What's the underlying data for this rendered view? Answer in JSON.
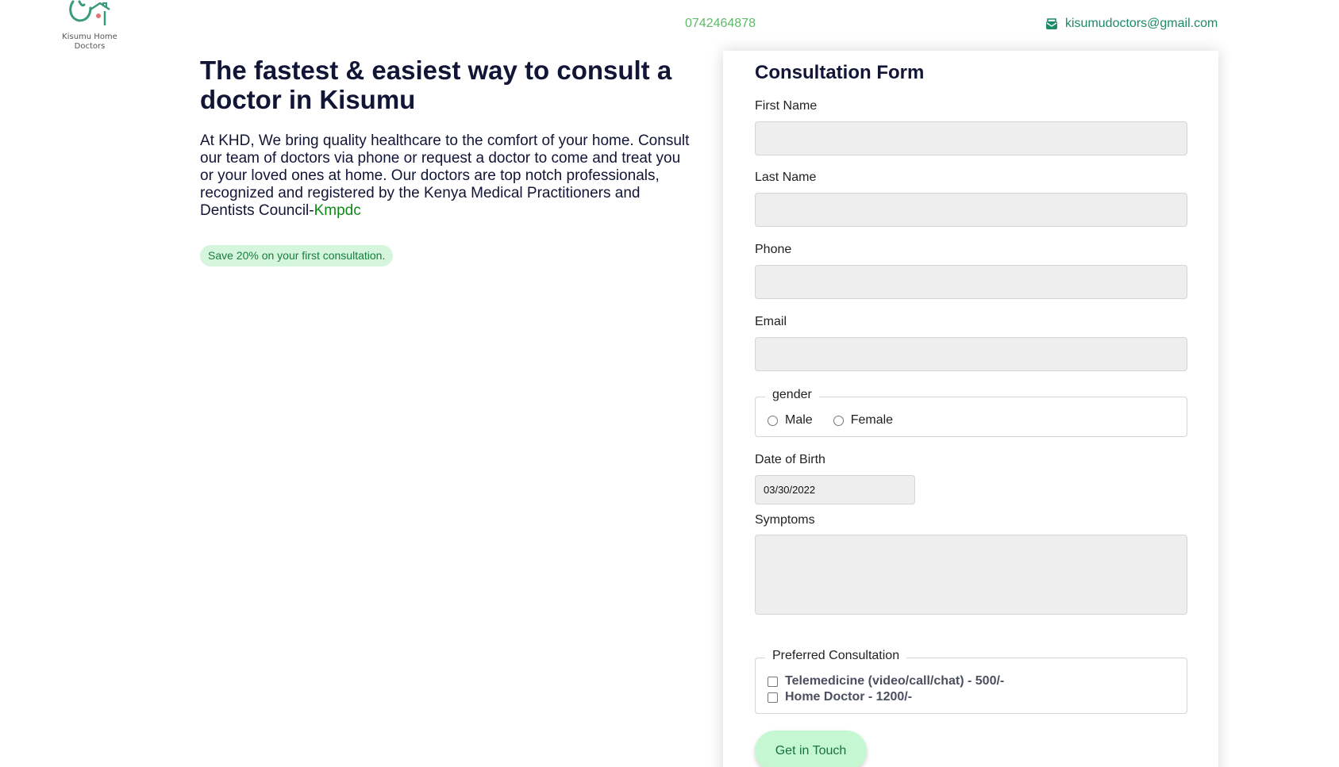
{
  "header": {
    "logo_text_line1": "Kisumu Home",
    "logo_text_line2": "Doctors",
    "phone": "0742464878",
    "email": "kisumudoctors@gmail.com"
  },
  "hero": {
    "title": "The fastest & easiest way to consult a doctor in Kisumu",
    "text": "At KHD, We bring quality healthcare to the comfort of your home. Consult our team of doctors via phone or request a doctor to come and treat you or your loved ones at home. Our doctors are top notch professionals, recognized and registered by the Kenya Medical Practitioners and Dentists Council-",
    "link_text": "Kmpdc",
    "promo": "Save 20% on your first consultation."
  },
  "form": {
    "title": "Consultation Form",
    "first_name_label": "First Name",
    "first_name_value": "",
    "last_name_label": "Last Name",
    "last_name_value": "",
    "phone_label": "Phone",
    "phone_value": "",
    "email_label": "Email",
    "email_value": "",
    "gender_legend": "gender",
    "gender_options": [
      "Male",
      "Female"
    ],
    "dob_label": "Date of Birth",
    "dob_value": "03/30/2022",
    "symptoms_label": "Symptoms",
    "symptoms_value": "",
    "consult_legend": "Preferred Consultation",
    "consult_options": [
      "Telemedicine (video/call/chat) - 500/-",
      "Home Doctor - 1200/-"
    ],
    "submit_label": "Get in Touch"
  },
  "colors": {
    "heading": "#111536",
    "accent_green": "#0e8a16",
    "phone_green": "#5fb96a",
    "email_teal": "#1d8a6a",
    "button_bg": "#c5f7d2",
    "promo_bg": "#d5f5dc"
  },
  "icons": {
    "logo": "stethoscope-house-icon",
    "email": "envelope-icon"
  }
}
